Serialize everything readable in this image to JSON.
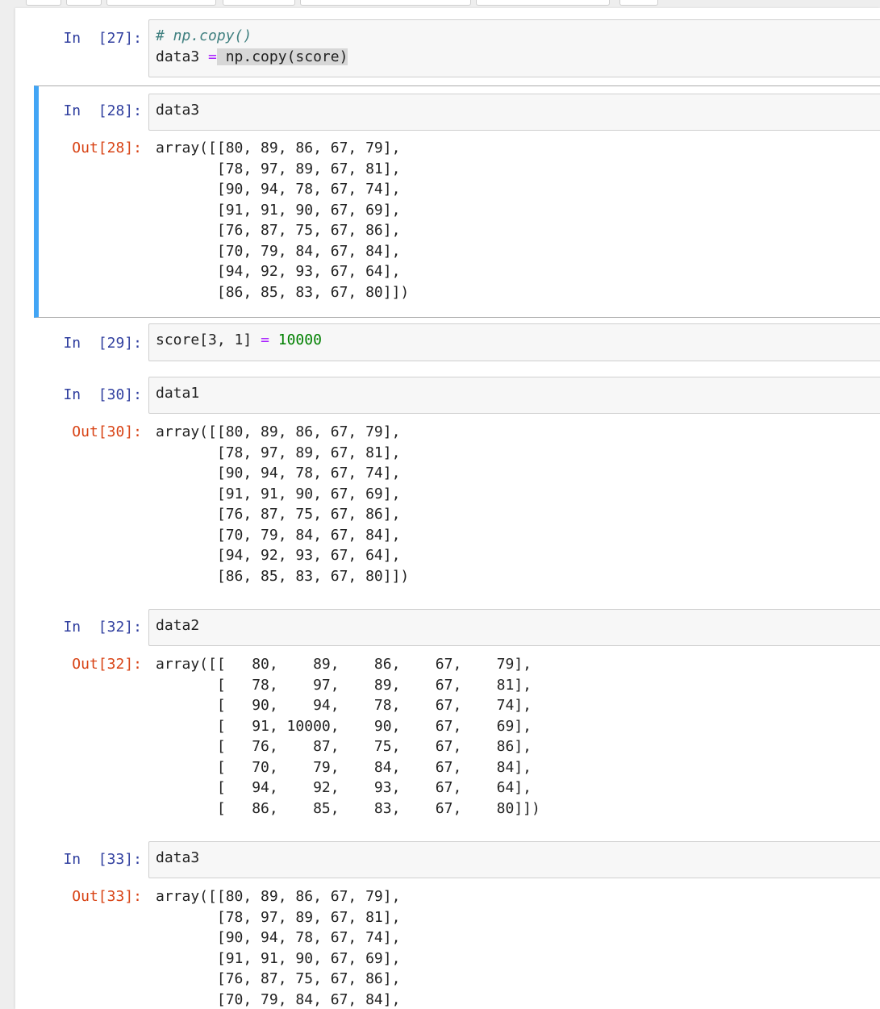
{
  "cells": [
    {
      "in_prompt": "In  [27]:",
      "comment": "# np.copy()",
      "line2_var": "data3",
      "line2_op": "=",
      "line2_call": " np.copy(score)"
    },
    {
      "in_prompt": "In  [28]:",
      "code": "data3",
      "out_prompt": "Out[28]:",
      "output": "array([[80, 89, 86, 67, 79],\n       [78, 97, 89, 67, 81],\n       [90, 94, 78, 67, 74],\n       [91, 91, 90, 67, 69],\n       [76, 87, 75, 67, 86],\n       [70, 79, 84, 67, 84],\n       [94, 92, 93, 67, 64],\n       [86, 85, 83, 67, 80]])"
    },
    {
      "in_prompt": "In  [29]:",
      "code_var": "score[3,",
      "code_idx": " 1]",
      "code_op": "=",
      "code_num": "10000"
    },
    {
      "in_prompt": "In  [30]:",
      "code": "data1",
      "out_prompt": "Out[30]:",
      "output": "array([[80, 89, 86, 67, 79],\n       [78, 97, 89, 67, 81],\n       [90, 94, 78, 67, 74],\n       [91, 91, 90, 67, 69],\n       [76, 87, 75, 67, 86],\n       [70, 79, 84, 67, 84],\n       [94, 92, 93, 67, 64],\n       [86, 85, 83, 67, 80]])"
    },
    {
      "in_prompt": "In  [32]:",
      "code": "data2",
      "out_prompt": "Out[32]:",
      "output": "array([[   80,    89,    86,    67,    79],\n       [   78,    97,    89,    67,    81],\n       [   90,    94,    78,    67,    74],\n       [   91, 10000,    90,    67,    69],\n       [   76,    87,    75,    67,    86],\n       [   70,    79,    84,    67,    84],\n       [   94,    92,    93,    67,    64],\n       [   86,    85,    83,    67,    80]])"
    },
    {
      "in_prompt": "In  [33]:",
      "code": "data3",
      "out_prompt": "Out[33]:",
      "output": "array([[80, 89, 86, 67, 79],\n       [78, 97, 89, 67, 81],\n       [90, 94, 78, 67, 74],\n       [91, 91, 90, 67, 69],\n       [76, 87, 75, 67, 86],\n       [70, 79, 84, 67, 84],"
    }
  ]
}
